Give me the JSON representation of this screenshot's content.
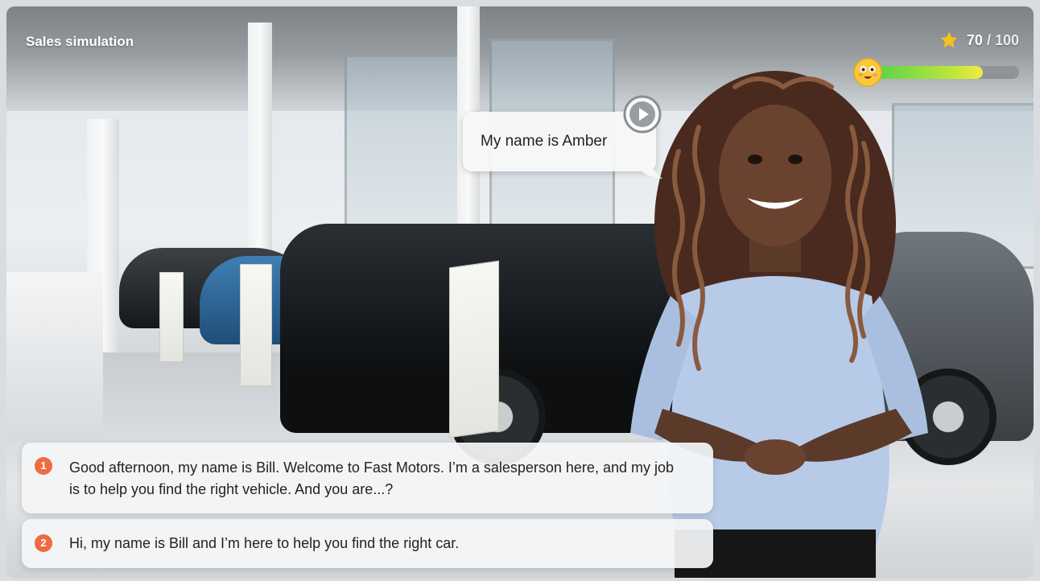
{
  "header": {
    "title": "Sales simulation",
    "score": "70",
    "score_max": " / 100"
  },
  "mood": {
    "icon": "smiling-face-icon",
    "level": 0.75,
    "colors": [
      "#56d24a",
      "#f2ea3c"
    ]
  },
  "character": {
    "line": "My name is Amber",
    "play_icon": "play-icon"
  },
  "choices": [
    {
      "number": "1",
      "text": "Good afternoon, my name is Bill. Welcome to Fast Motors. I’m a salesperson here, and my job is to help you find the right vehicle. And you are...?"
    },
    {
      "number": "2",
      "text": "Hi, my name is Bill and I’m here to help you find the right car."
    }
  ],
  "colors": {
    "accent": "#f06a43",
    "star": "#f5c11d"
  }
}
